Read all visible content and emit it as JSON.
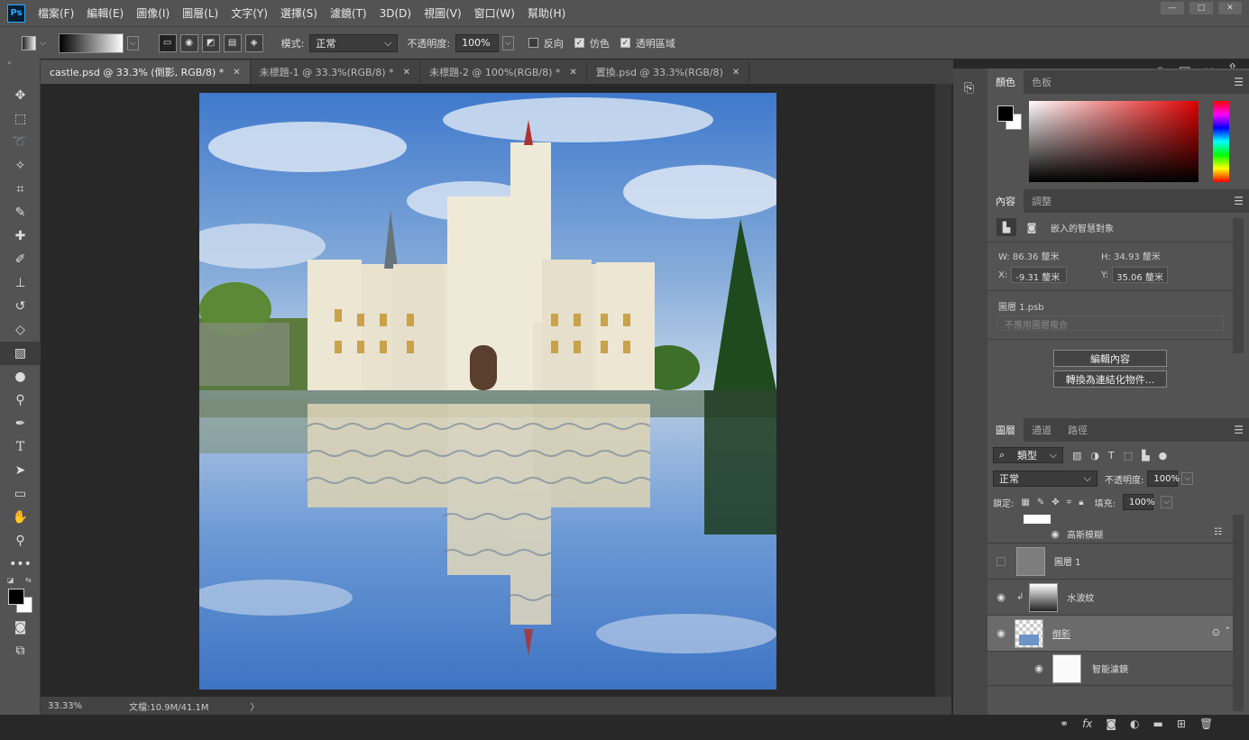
{
  "menubar": {
    "logo": "Ps",
    "items": [
      "檔案(F)",
      "編輯(E)",
      "圖像(I)",
      "圖層(L)",
      "文字(Y)",
      "選擇(S)",
      "濾鏡(T)",
      "3D(D)",
      "視圖(V)",
      "窗口(W)",
      "幫助(H)"
    ]
  },
  "options": {
    "mode_label": "模式:",
    "mode_value": "正常",
    "opacity_label": "不透明度:",
    "opacity_value": "100%",
    "reverse_label": "反向",
    "dither_label": "仿色",
    "transparency_label": "透明區域",
    "reverse_checked": false,
    "dither_checked": true,
    "transparency_checked": true
  },
  "tabs": [
    {
      "label": "castle.psd @ 33.3% (倒影, RGB/8) *",
      "active": true
    },
    {
      "label": "未標題-1 @ 33.3%(RGB/8) *",
      "active": false
    },
    {
      "label": "未標題-2 @ 100%(RGB/8) *",
      "active": false
    },
    {
      "label": "置換.psd @ 33.3%(RGB/8)",
      "active": false
    }
  ],
  "status": {
    "zoom": "33.33%",
    "doc": "文檔:10.9M/41.1M",
    "arrow": "〉"
  },
  "color_panel": {
    "tabs": [
      "顏色",
      "色板"
    ],
    "foreground": "#000000",
    "background": "#ffffff"
  },
  "properties_panel": {
    "tabs": [
      "內容",
      "調整"
    ],
    "object_type": "嵌入的智慧對象",
    "w_label": "W:",
    "w_value": "86.36 釐米",
    "h_label": "H:",
    "h_value": "34.93 釐米",
    "x_label": "X:",
    "x_value": "-9.31 釐米",
    "y_label": "Y:",
    "y_value": "35.06 釐米",
    "file_name": "圖層 1.psb",
    "comp_placeholder": "不應用圖層複合",
    "edit_button": "編輯內容",
    "convert_button": "轉換為連結化物件..."
  },
  "layers_panel": {
    "tabs": [
      "圖層",
      "通道",
      "路徑"
    ],
    "filter_label": "類型",
    "blend_mode": "正常",
    "opacity_label": "不透明度:",
    "opacity_value": "100%",
    "lock_label": "鎖定:",
    "fill_label": "填充:",
    "fill_value": "100%",
    "layers": [
      {
        "name": "高斯模糊",
        "type": "filter",
        "visible": true
      },
      {
        "name": "圖層 1",
        "type": "layer",
        "visible": false
      },
      {
        "name": "水波紋",
        "type": "layer",
        "visible": true
      },
      {
        "name": "倒影",
        "type": "smart",
        "visible": true,
        "selected": true
      },
      {
        "name": "智能濾鏡",
        "type": "filter-group",
        "visible": true
      }
    ]
  }
}
